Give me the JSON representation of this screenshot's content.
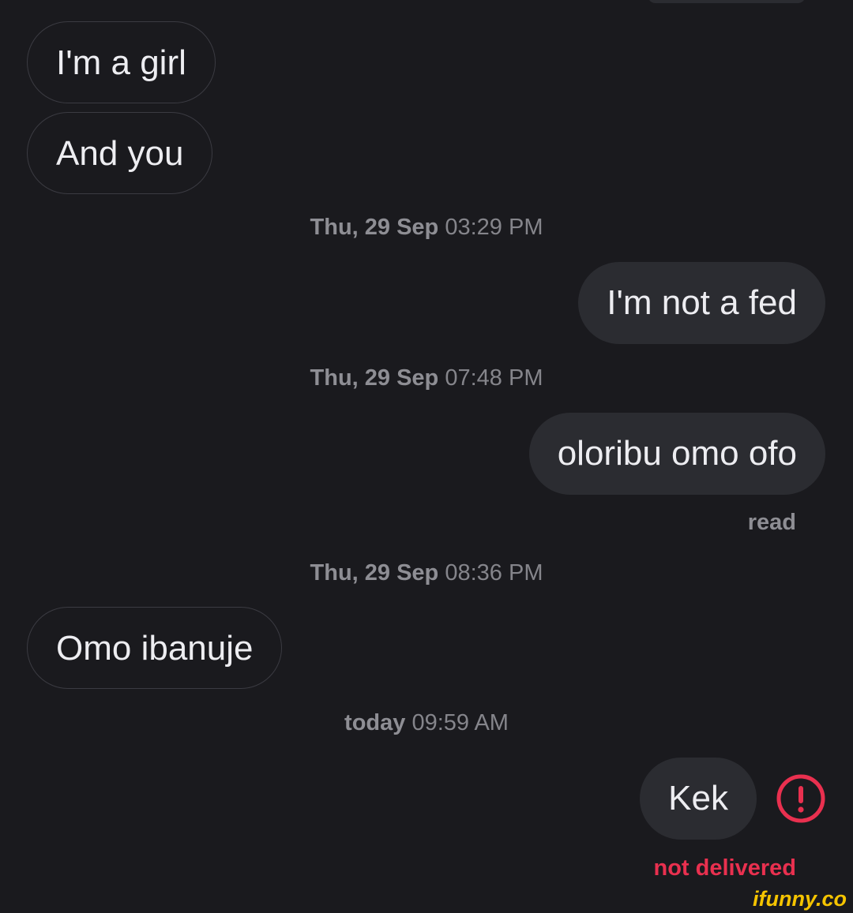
{
  "colors": {
    "background": "#1a1a1e",
    "incoming_border": "#3b3b42",
    "outgoing_bubble": "#2b2c31",
    "message_text": "#ededf1",
    "meta_text": "#8e8e94",
    "error": "#e9304f",
    "watermark": "#f5c400"
  },
  "messages": {
    "m1": "I'm a girl",
    "m2": "And you",
    "m3": "I'm not a fed",
    "m4": "oloribu omo ofo",
    "m5": "Omo ibanuje",
    "m6": "Kek"
  },
  "timestamps": {
    "t1": {
      "day": "Thu, 29 Sep",
      "time": "03:29 PM"
    },
    "t2": {
      "day": "Thu, 29 Sep",
      "time": "07:48 PM"
    },
    "t3": {
      "day": "Thu, 29 Sep",
      "time": "08:36 PM"
    },
    "t4": {
      "day": "today",
      "time": "09:59 AM"
    }
  },
  "status": {
    "read": "read",
    "not_delivered": "not delivered"
  },
  "icons": {
    "error": "exclamation-circle-icon"
  },
  "watermark": "ifunny.co"
}
